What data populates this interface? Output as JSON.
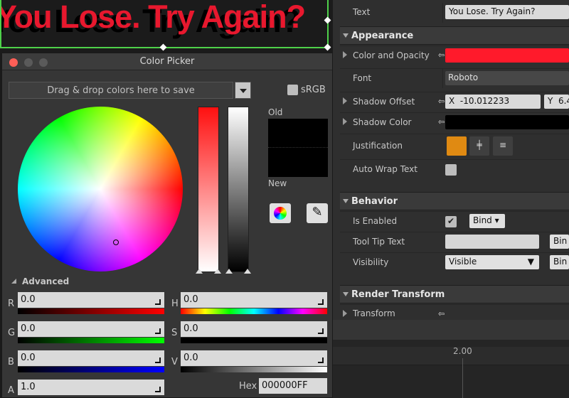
{
  "designer": {
    "preview_text": "You Lose. Try Again?"
  },
  "details": {
    "text_row": {
      "label": "Text",
      "value": "You Lose. Try Again?"
    },
    "appearance": {
      "header": "Appearance",
      "color_and_opacity": {
        "label": "Color and Opacity",
        "color": "#ff1a2b"
      },
      "font": {
        "label": "Font",
        "value": "Roboto"
      },
      "shadow_offset": {
        "label": "Shadow Offset",
        "x_label": "X",
        "x_value": "-10.012233",
        "y_label": "Y",
        "y_value": "6.4"
      },
      "shadow_color": {
        "label": "Shadow Color",
        "color": "#000000"
      },
      "justification": {
        "label": "Justification"
      },
      "auto_wrap": {
        "label": "Auto Wrap Text"
      }
    },
    "behavior": {
      "header": "Behavior",
      "is_enabled": {
        "label": "Is Enabled",
        "bind": "Bind"
      },
      "tool_tip": {
        "label": "Tool Tip Text",
        "bind": "Bin"
      },
      "visibility": {
        "label": "Visibility",
        "value": "Visible",
        "bind": "Bin"
      }
    },
    "render_transform": {
      "header": "Render Transform",
      "transform": {
        "label": "Transform"
      }
    }
  },
  "timeline": {
    "tick_label": "2.00"
  },
  "picker": {
    "title": "Color Picker",
    "dropzone": "Drag & drop colors here to save",
    "srgb": "sRGB",
    "old_label": "Old",
    "new_label": "New",
    "advanced": "Advanced",
    "r": {
      "label": "R",
      "value": "0.0"
    },
    "g": {
      "label": "G",
      "value": "0.0"
    },
    "b": {
      "label": "B",
      "value": "0.0"
    },
    "a": {
      "label": "A",
      "value": "1.0"
    },
    "h": {
      "label": "H",
      "value": "0.0"
    },
    "s": {
      "label": "S",
      "value": "0.0"
    },
    "v": {
      "label": "V",
      "value": "0.0"
    },
    "hex": {
      "label": "Hex",
      "value": "000000FF"
    }
  }
}
